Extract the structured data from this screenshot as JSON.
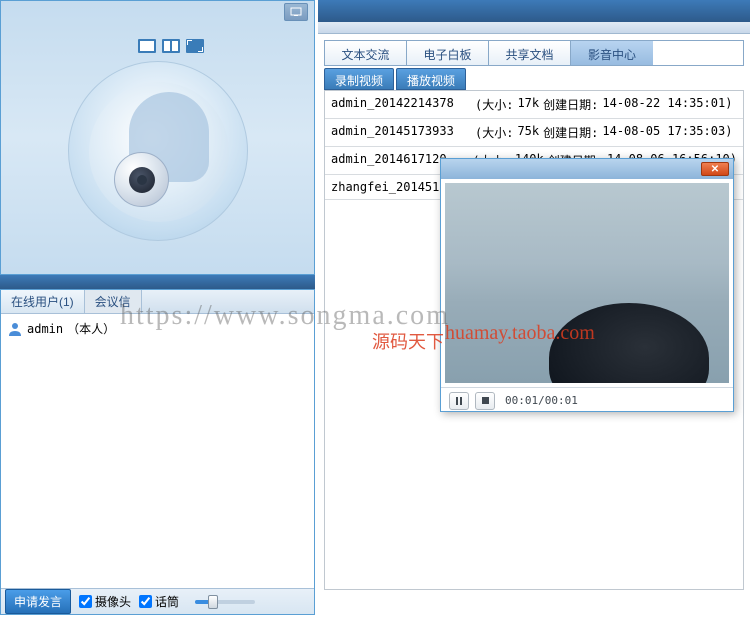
{
  "left": {
    "tabs": {
      "online_users": "在线用户(1)",
      "meeting": "会议信"
    },
    "users": [
      {
        "name": "admin",
        "suffix": "（本人）"
      }
    ],
    "bottom": {
      "speak_button": "申请发言",
      "camera_label": "摄像头",
      "mic_label": "话筒"
    }
  },
  "right": {
    "main_tabs": [
      "文本交流",
      "电子白板",
      "共享文档",
      "影音中心"
    ],
    "active_main_tab_index": 3,
    "sub_tabs": [
      "录制视频",
      "播放视频"
    ],
    "files": [
      {
        "name": "admin_20142214378",
        "size_label": "(大小:",
        "size": "17k",
        "date_label": "创建日期:",
        "date": "14-08-22 14:35:01)"
      },
      {
        "name": "admin_20145173933",
        "size_label": "(大小:",
        "size": "75k",
        "date_label": "创建日期:",
        "date": "14-08-05 17:35:03)"
      },
      {
        "name": "admin_2014617120",
        "size_label": "(大小:",
        "size": "140k",
        "date_label": "创建日期:",
        "date": "14-08-06 16:56:10)"
      },
      {
        "name": "zhangfei_2014517",
        "size_label": "",
        "size": "",
        "date_label": "",
        "date": ""
      }
    ]
  },
  "player": {
    "time": "00:01/00:01"
  },
  "watermarks": {
    "main": "https://www.songma.com",
    "sub1": "源码天下",
    "sub2": "huamay.taoba.com"
  }
}
